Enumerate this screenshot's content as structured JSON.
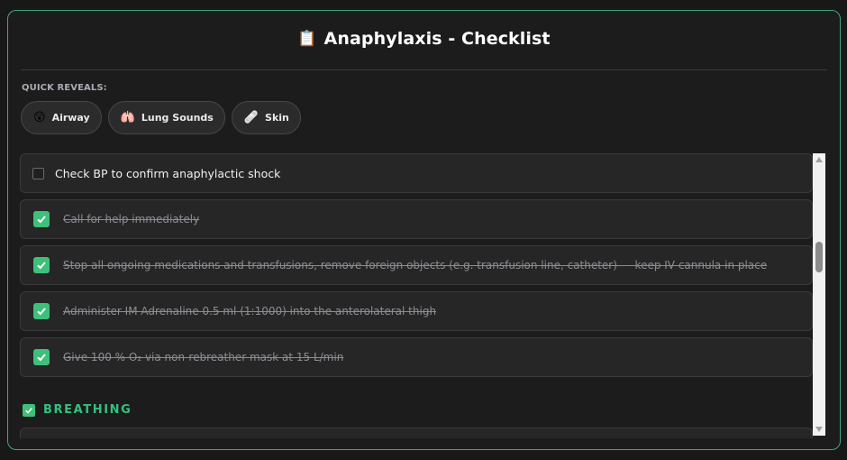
{
  "header": {
    "icon": "clipboard-icon",
    "title": "Anaphylaxis - Checklist"
  },
  "quick_reveals": {
    "label": "QUICK REVEALS:",
    "chips": [
      {
        "icon": "astonished-face-icon",
        "label": "Airway"
      },
      {
        "icon": "lungs-icon",
        "label": "Lung Sounds"
      },
      {
        "icon": "bandage-icon",
        "label": "Skin"
      }
    ]
  },
  "checklist": {
    "items": [
      {
        "text": "Check BP to confirm anaphylactic shock",
        "checked": false
      },
      {
        "text": "Call for help immediately",
        "checked": true
      },
      {
        "text": "Stop all ongoing medications and transfusions, remove foreign objects (e.g. transfusion line, catheter) — keep IV cannula in place",
        "checked": true
      },
      {
        "text": "Administer IM Adrenaline 0.5 ml (1:1000) into the anterolateral thigh",
        "checked": true
      },
      {
        "text": "Give 100 % O₂ via non-rebreather mask at 15 L/min",
        "checked": true
      }
    ]
  },
  "section": {
    "label": "BREATHING",
    "checked": true
  },
  "colors": {
    "accent": "#3ec07a",
    "border": "#3fa67b",
    "background": "#1c1c1c"
  }
}
